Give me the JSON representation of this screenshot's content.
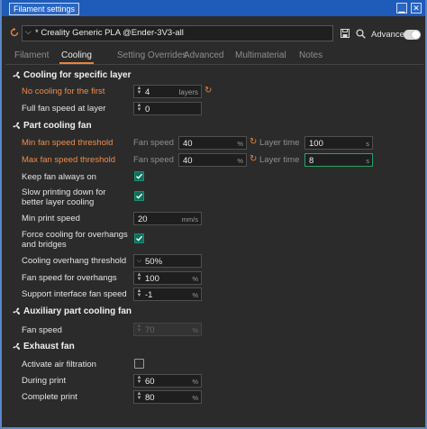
{
  "window": {
    "title": "Filament settings",
    "controls": [
      "minimize-icon",
      "close-icon"
    ]
  },
  "preset": {
    "name": "* Creality Generic PLA @Ender-3V3-all",
    "advanced_label": "Advanced",
    "advanced_on": true
  },
  "tabs": [
    {
      "label": "Filament",
      "active": false
    },
    {
      "label": "Cooling",
      "active": true
    },
    {
      "label": "Setting Overrides",
      "active": false
    },
    {
      "label": "Advanced",
      "active": false
    },
    {
      "label": "Multimaterial",
      "active": false
    },
    {
      "label": "Notes",
      "active": false
    }
  ],
  "sections": {
    "cooling_layer": {
      "title": "Cooling for specific layer",
      "no_cooling_label": "No cooling for the first",
      "no_cooling_value": "4",
      "no_cooling_unit": "layers",
      "full_fan_label": "Full fan speed at layer",
      "full_fan_value": "0"
    },
    "part_fan": {
      "title": "Part cooling fan",
      "min_label": "Min fan speed threshold",
      "min_fan_sub": "Fan speed",
      "min_fan_value": "40",
      "min_fan_unit": "%",
      "min_layer_sub": "Layer time",
      "min_layer_value": "100",
      "min_layer_unit": "s",
      "max_label": "Max fan speed threshold",
      "max_fan_sub": "Fan speed",
      "max_fan_value": "40",
      "max_fan_unit": "%",
      "max_layer_sub": "Layer time",
      "max_layer_value": "8",
      "max_layer_unit": "s",
      "keep_on_label": "Keep fan always on",
      "slow_label_1": "Slow printing down for",
      "slow_label_2": "better layer cooling",
      "min_print_label": "Min print speed",
      "min_print_value": "20",
      "min_print_unit": "mm/s",
      "force_label_1": "Force cooling for overhangs",
      "force_label_2": "and bridges",
      "overhang_thr_label": "Cooling overhang threshold",
      "overhang_thr_value": "50%",
      "fan_overhang_label": "Fan speed for overhangs",
      "fan_overhang_value": "100",
      "fan_overhang_unit": "%",
      "support_fan_label": "Support interface fan speed",
      "support_fan_value": "-1",
      "support_fan_unit": "%"
    },
    "aux_fan": {
      "title": "Auxiliary part cooling fan",
      "fan_speed_label": "Fan speed",
      "fan_speed_value": "70",
      "fan_speed_unit": "%"
    },
    "exhaust_fan": {
      "title": "Exhaust fan",
      "air_filter_label": "Activate air filtration",
      "during_label": "During print",
      "during_value": "60",
      "during_unit": "%",
      "complete_label": "Complete print",
      "complete_value": "80",
      "complete_unit": "%"
    }
  },
  "checkboxes": {
    "keep_fan_on": true,
    "slow_down": true,
    "force_cooling": true,
    "air_filtration": false
  },
  "colors": {
    "accent": "#e8843b",
    "modified_label": "#f28b4a",
    "check_on": "#0f6f5c",
    "titlebar": "#1f5bb8"
  }
}
